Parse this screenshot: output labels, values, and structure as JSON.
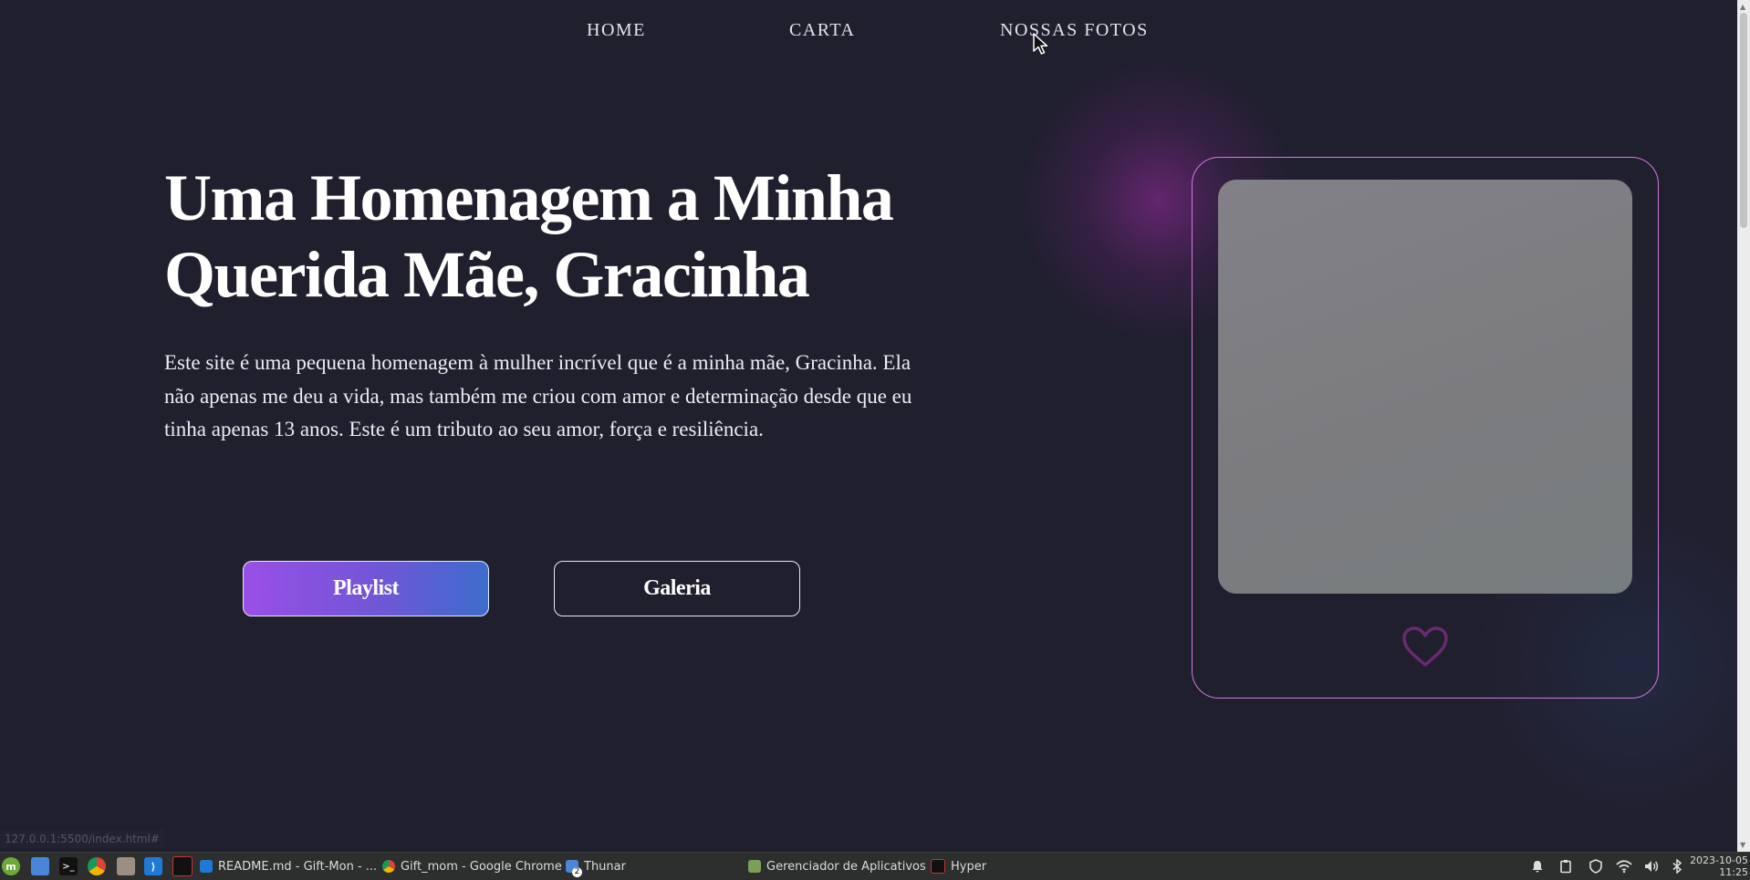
{
  "nav": {
    "items": [
      {
        "label": "HOME"
      },
      {
        "label": "CARTA"
      },
      {
        "label": "NOSSAS FOTOS"
      }
    ]
  },
  "hero": {
    "title": "Uma Homenagem a Minha Querida Mãe, Gracinha",
    "description": "Este site é uma pequena homenagem à mulher incrível que é a minha mãe, Gracinha. Ela não apenas me deu a vida, mas também me criou com amor e determinação desde que eu tinha apenas 13 anos. Este é um tributo ao seu amor, força e resiliência.",
    "primary_button": "Playlist",
    "secondary_button": "Galeria"
  },
  "card": {
    "icon": "heart-outline-icon"
  },
  "status_bar": {
    "url": "127.0.0.1:5500/index.html#"
  },
  "taskbar": {
    "launchers": [
      "mint-menu-icon",
      "file-manager-icon",
      "terminal-icon",
      "chrome-icon",
      "image-viewer-icon",
      "vscode-icon",
      "hyper-terminal-icon"
    ],
    "windows": [
      {
        "label": "README.md - Gift-Mon - ...",
        "icon": "vscode-icon"
      },
      {
        "label": "Gift_mom - Google Chrome",
        "icon": "chrome-icon"
      },
      {
        "label": "Thunar",
        "icon": "folder-icon",
        "badge": "2"
      },
      {
        "label": "Gerenciador de Aplicativos",
        "icon": "app-manager-icon"
      },
      {
        "label": "Hyper",
        "icon": "hyper-terminal-icon"
      }
    ],
    "tray": [
      "bell-icon",
      "clipboard-icon",
      "shield-icon",
      "wifi-icon",
      "volume-icon",
      "bluetooth-icon"
    ],
    "clock": {
      "date": "2023-10-05",
      "time": "11:25"
    }
  },
  "colors": {
    "background": "#201f2e",
    "accent_border": "#d677e0",
    "gradient_start": "#9a4fe6",
    "gradient_end": "#3e6ccc"
  }
}
